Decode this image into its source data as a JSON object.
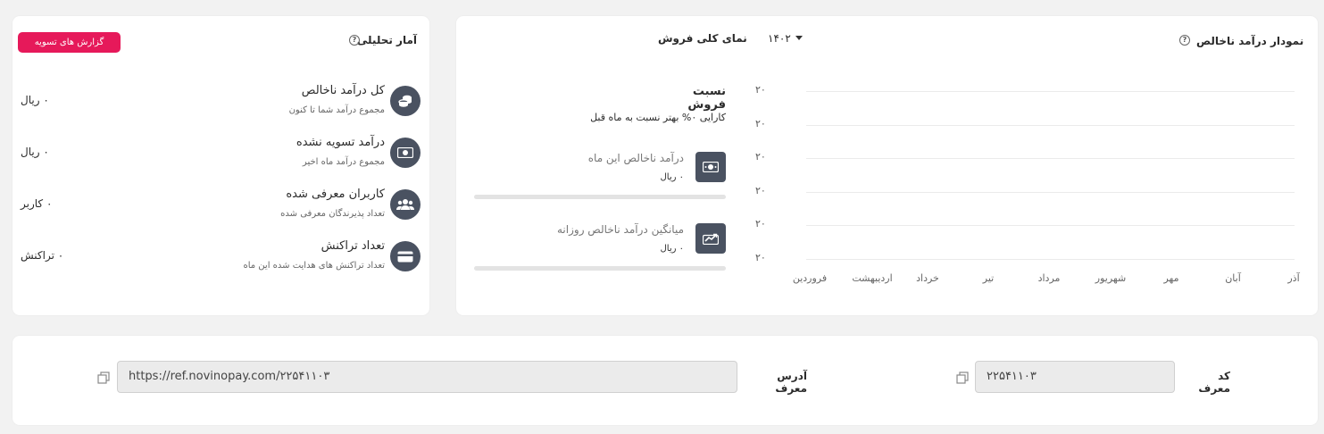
{
  "analytics": {
    "title": "آمار تحلیلی",
    "help": "?",
    "settlement_button": "گزارش های تسویه",
    "items": [
      {
        "title": "کل درآمد ناخالص",
        "subtitle": "مجموع درآمد شما تا کنون",
        "value": "۰ ریال",
        "icon": "coins-icon"
      },
      {
        "title": "درآمد تسویه نشده",
        "subtitle": "مجموع درآمد ماه اخیر",
        "value": "۰ ریال",
        "icon": "cash-icon"
      },
      {
        "title": "کاربران معرفی شده",
        "subtitle": "تعداد پذیرندگان معرفی شده",
        "value": "۰ کاربر",
        "icon": "users-icon"
      },
      {
        "title": "تعداد تراکنش",
        "subtitle": "تعداد تراکنش های هدایت شده این ماه",
        "value": "۰ تراکنش",
        "icon": "card-icon"
      }
    ]
  },
  "overview": {
    "chart_title": "نمودار درآمد ناخالص",
    "help": "?",
    "year": "۱۴۰۲",
    "sales_title": "نمای کلی فروش",
    "ratio_title": "نسبت فروش",
    "ratio_subtitle": "کارایی ۰% بهتر نسبت به ماه قبل",
    "stats": [
      {
        "label": "درآمد ناخالص این ماه",
        "value": "۰ ریال",
        "progress": 0,
        "icon": "cash-icon"
      },
      {
        "label": "میانگین درآمد ناخالص روزانه",
        "value": "۰ ریال",
        "progress": 0,
        "icon": "trend-icon"
      }
    ]
  },
  "chart_data": {
    "type": "line",
    "categories": [
      "فروردین",
      "اردیبهشت",
      "خرداد",
      "تیر",
      "مرداد",
      "شهریور",
      "مهر",
      "آبان",
      "آذر"
    ],
    "yticks": [
      "۲۰",
      "۲۰",
      "۲۰",
      "۲۰",
      "۲۰",
      "۲۰"
    ],
    "series": [],
    "grid": true
  },
  "referral": {
    "code_label": "کد معرف",
    "code_value": "۲۲۵۴۱۱۰۳",
    "address_label": "آدرس معرف",
    "address_value": "https://ref.novinopay.com/۲۲۵۴۱۱۰۳"
  }
}
